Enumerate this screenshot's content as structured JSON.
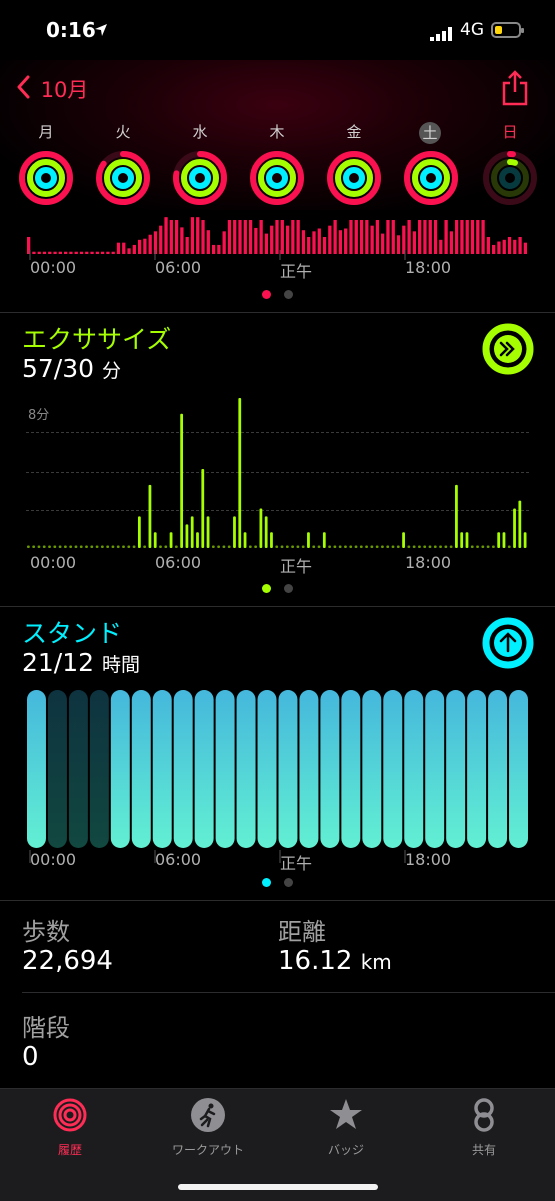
{
  "status_bar": {
    "time": "0:16",
    "network": "4G"
  },
  "header": {
    "back_label": "10月"
  },
  "week": {
    "days": [
      "月",
      "火",
      "水",
      "木",
      "金",
      "土",
      "日"
    ]
  },
  "move_chart": {
    "x_ticks": [
      "00:00",
      "06:00",
      "正午",
      "18:00"
    ]
  },
  "exercise": {
    "title": "エクササイズ",
    "value": "57/30",
    "unit": "分",
    "chart_label": "8分",
    "x_ticks": [
      "00:00",
      "06:00",
      "正午",
      "18:00"
    ]
  },
  "stand": {
    "title": "スタンド",
    "value": "21/12",
    "unit": "時間",
    "x_ticks": [
      "00:00",
      "06:00",
      "正午",
      "18:00"
    ]
  },
  "stats": {
    "steps_label": "歩数",
    "steps_value": "22,694",
    "distance_label": "距離",
    "distance_value": "16.12",
    "distance_unit": "km",
    "floors_label": "階段",
    "floors_value": "0"
  },
  "tabbar": {
    "tabs": [
      {
        "label": "履歴",
        "icon": "activity-rings-icon"
      },
      {
        "label": "ワークアウト",
        "icon": "running-figure-icon"
      },
      {
        "label": "バッジ",
        "icon": "star-badge-icon"
      },
      {
        "label": "共有",
        "icon": "sharing-icon"
      }
    ]
  },
  "colors": {
    "move": "#fa114f",
    "exercise": "#a6ff00",
    "stand": "#00f0ff",
    "accent": "#ff2d55"
  },
  "chart_data": [
    {
      "type": "bar",
      "name": "move",
      "x_ticks": [
        "00:00",
        "06:00",
        "正午",
        "18:00"
      ],
      "values": [
        3,
        0.4,
        0.4,
        0.4,
        0.4,
        0.4,
        0.4,
        0.4,
        0.4,
        0.4,
        0.4,
        0.4,
        0.4,
        0.4,
        0.4,
        0.4,
        0.4,
        2,
        2,
        1,
        1.6,
        2.5,
        2.7,
        3.4,
        4,
        5,
        6.5,
        6,
        6,
        4.7,
        3,
        6.5,
        6.5,
        6,
        4.2,
        1.6,
        1.6,
        4,
        6,
        6,
        6,
        6,
        6,
        4.6,
        6,
        3.6,
        5,
        6,
        6,
        5,
        6,
        6,
        4.2,
        3,
        4,
        4.5,
        3,
        5,
        6,
        4.2,
        4.5,
        6,
        6,
        6,
        6,
        5,
        6,
        3.6,
        6,
        6,
        3.3,
        5,
        6,
        4,
        6,
        6,
        6,
        6,
        2.5,
        6,
        4,
        6,
        6,
        6,
        6,
        6,
        6,
        3,
        1.6,
        2.2,
        2.5,
        3,
        2.5,
        3,
        2
      ]
    },
    {
      "type": "bar",
      "name": "exercise",
      "x_ticks": [
        "00:00",
        "06:00",
        "正午",
        "18:00"
      ],
      "y_label": "8分",
      "values": [
        0,
        0,
        0,
        0,
        0,
        0,
        0,
        0,
        0,
        0,
        0,
        0,
        0,
        0,
        0,
        0,
        0,
        0,
        0,
        0,
        0,
        2,
        0,
        4,
        1,
        0,
        0,
        1,
        0,
        8.5,
        1.5,
        2,
        1,
        5,
        2,
        0,
        0,
        0,
        0,
        2,
        9.5,
        1,
        0,
        0,
        2.5,
        2,
        1,
        0,
        0,
        0,
        0,
        0,
        0,
        1,
        0,
        0,
        1,
        0,
        0,
        0,
        0,
        0,
        0,
        0,
        0,
        0,
        0,
        0,
        0,
        0,
        0,
        1,
        0,
        0,
        0,
        0,
        0,
        0,
        0,
        0,
        0,
        4,
        1,
        1,
        0,
        0,
        0,
        0,
        0,
        1,
        1,
        0,
        2.5,
        3,
        1
      ]
    },
    {
      "type": "bar",
      "name": "stand",
      "x_ticks": [
        "00:00",
        "06:00",
        "正午",
        "18:00"
      ],
      "categories": [
        "0",
        "1",
        "2",
        "3",
        "4",
        "5",
        "6",
        "7",
        "8",
        "9",
        "10",
        "11",
        "12",
        "13",
        "14",
        "15",
        "16",
        "17",
        "18",
        "19",
        "20",
        "21",
        "22",
        "23"
      ],
      "values": [
        1,
        0,
        0,
        0,
        1,
        1,
        1,
        1,
        1,
        1,
        1,
        1,
        1,
        1,
        1,
        1,
        1,
        1,
        1,
        1,
        1,
        1,
        1,
        1
      ]
    }
  ]
}
